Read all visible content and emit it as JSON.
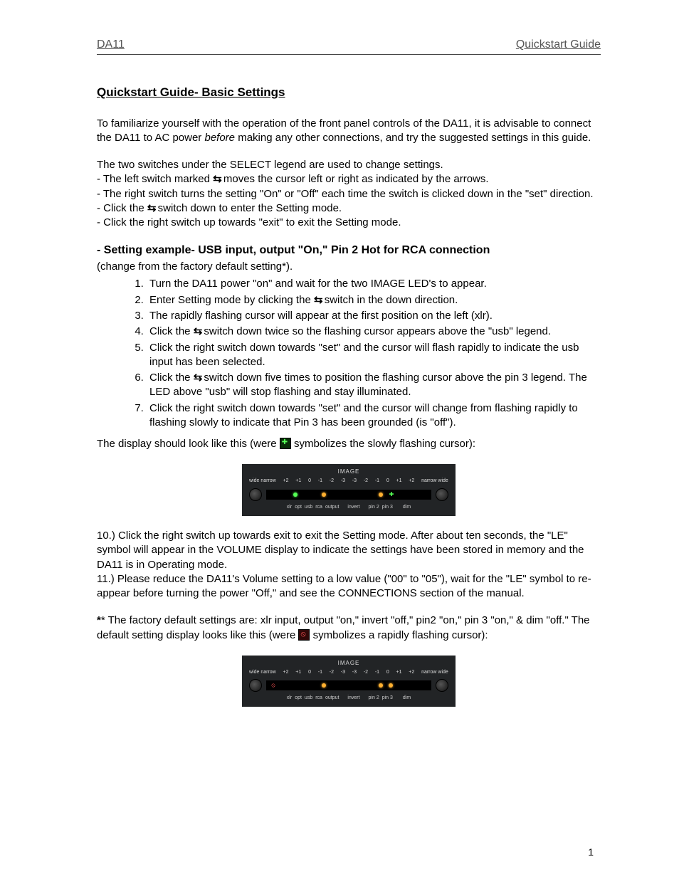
{
  "header": {
    "left": "DA11",
    "right": "Quickstart Guide"
  },
  "title": "Quickstart Guide- Basic Settings",
  "intro_a": "To familiarize yourself with the operation of the front panel controls of the DA11, it is advisable to connect the DA11 to AC power ",
  "intro_b_italic": "before",
  "intro_c": " making any other connections, and try the suggested settings in this guide.",
  "p2": "The two switches under the SELECT legend are used to change settings.",
  "p2a_pre": "- The left switch marked ",
  "p2a_post": " moves the cursor left or right as indicated by the arrows.",
  "p2b": "- The right switch turns the setting \"On\" or \"Off\" each time the switch is clicked down in the \"set\" direction.",
  "p2c_pre": "- Click the ",
  "p2c_post": " switch down to enter the Setting mode.",
  "p2d": "- Click the right switch up towards \"exit\" to exit the Setting mode.",
  "sub_heading": "- Setting example- USB input, output \"On,\" Pin 2 Hot for RCA connection",
  "sub_note": "(change from the factory default setting*).",
  "steps": {
    "s1": "Turn the DA11 power \"on\" and wait for the two IMAGE LED's to appear.",
    "s2_pre": "Enter Setting mode by clicking the ",
    "s2_post": " switch in the down direction.",
    "s3": "The rapidly flashing cursor will appear at the first position on the left (xlr).",
    "s4_pre": "Click the ",
    "s4_post": " switch down twice so the flashing cursor appears above the \"usb\" legend.",
    "s5": "Click the right switch down towards \"set\" and the cursor will flash rapidly to indicate the usb input has been selected.",
    "s6_pre": "Click the ",
    "s6_post": " switch down five times to position the flashing cursor above the pin 3 legend. The LED above \"usb\" will stop flashing and stay illuminated.",
    "s7": "Click the right switch down towards \"set\" and the cursor will change from flashing rapidly to flashing slowly to indicate that Pin 3 has been grounded (is \"off\")."
  },
  "display_intro_pre": "The display should look like this (were ",
  "display_intro_post": " symbolizes the slowly flashing cursor):",
  "p10": "10.) Click the right switch up towards exit to exit the Setting mode. After about ten seconds, the \"LE\" symbol will appear in the VOLUME display to indicate the settings have been stored in memory and the DA11 is in Operating mode.",
  "p11": "11.) Please reduce the DA11's Volume setting to a low value (\"00\" to \"05\"), wait for the \"LE\" symbol to re-appear before turning the power \"Off,\" and see the CONNECTIONS section of the manual.",
  "footnote_pre": "* The factory default settings are: xlr input, output \"on,\" invert \"off,\" pin2 \"on,\"  pin 3 \"on,\" & dim \"off.\" The default setting display looks like this (were ",
  "footnote_post": " symbolizes a rapidly flashing cursor):",
  "panel": {
    "image_label": "IMAGE",
    "scale_left": "wide narrow",
    "scale_right": "narrow wide",
    "scale_values": [
      "+2",
      "+1",
      "0",
      "-1",
      "-2",
      "-3",
      "-3",
      "-2",
      "-1",
      "0",
      "+1",
      "+2"
    ],
    "labels": [
      "xlr",
      "opt",
      "usb",
      "rca",
      "output",
      "invert",
      "pin 2",
      "pin 3",
      "dim"
    ]
  },
  "swap_glyph": "⇆",
  "page_number": "1"
}
